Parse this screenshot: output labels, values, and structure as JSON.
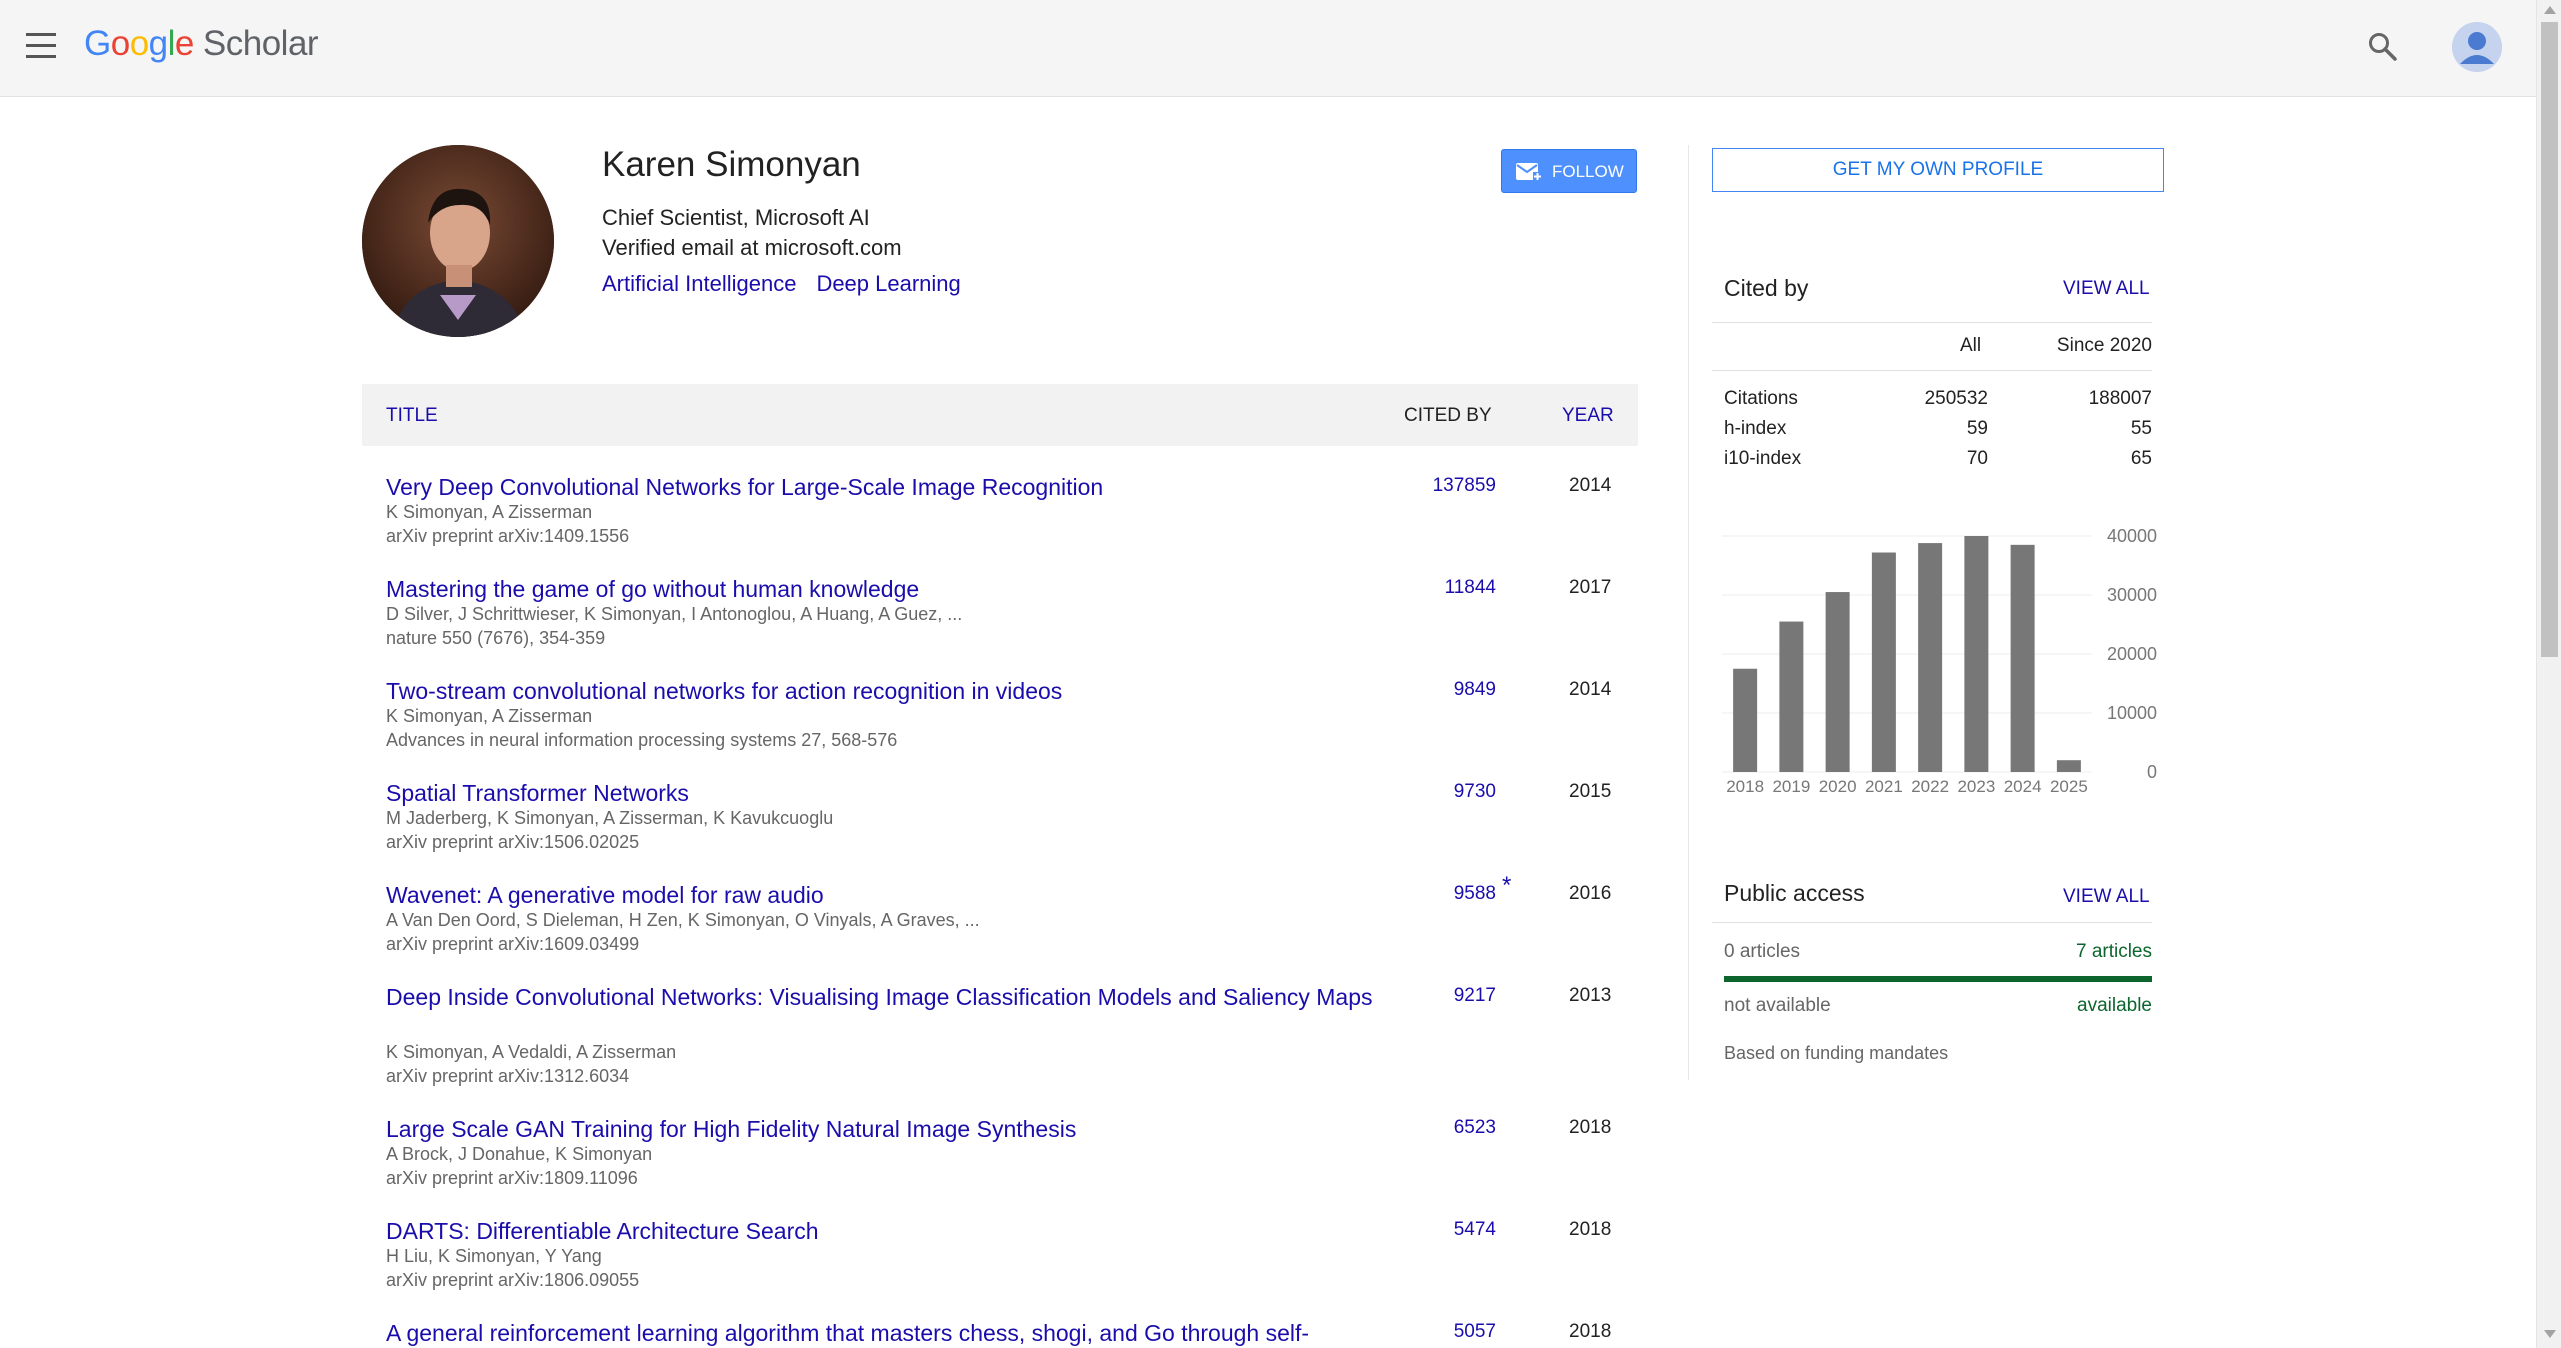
{
  "header": {
    "logo_letters": [
      "G",
      "o",
      "o",
      "g",
      "l",
      "e"
    ],
    "product": "Scholar"
  },
  "profile": {
    "name": "Karen Simonyan",
    "affiliation": "Chief Scientist, Microsoft AI",
    "email": "Verified email at microsoft.com",
    "interests": [
      "Artificial Intelligence",
      "Deep Learning"
    ],
    "follow_label": "FOLLOW"
  },
  "table": {
    "headers": {
      "title": "TITLE",
      "cited_by": "CITED BY",
      "year": "YEAR"
    },
    "rows": [
      {
        "title": "Very Deep Convolutional Networks for Large-Scale Image Recognition",
        "authors": "K Simonyan, A Zisserman",
        "venue": "arXiv preprint arXiv:1409.1556",
        "cited": "137859",
        "year": "2014",
        "star": ""
      },
      {
        "title": "Mastering the game of go without human knowledge",
        "authors": "D Silver, J Schrittwieser, K Simonyan, I Antonoglou, A Huang, A Guez, ...",
        "venue": "nature 550 (7676), 354-359",
        "cited": "11844",
        "year": "2017",
        "star": ""
      },
      {
        "title": "Two-stream convolutional networks for action recognition in videos",
        "authors": "K Simonyan, A Zisserman",
        "venue": "Advances in neural information processing systems 27, 568-576",
        "cited": "9849",
        "year": "2014",
        "star": ""
      },
      {
        "title": "Spatial Transformer Networks",
        "authors": "M Jaderberg, K Simonyan, A Zisserman, K Kavukcuoglu",
        "venue": "arXiv preprint arXiv:1506.02025",
        "cited": "9730",
        "year": "2015",
        "star": ""
      },
      {
        "title": "Wavenet: A generative model for raw audio",
        "authors": "A Van Den Oord, S Dieleman, H Zen, K Simonyan, O Vinyals, A Graves, ...",
        "venue": "arXiv preprint arXiv:1609.03499",
        "cited": "9588",
        "year": "2016",
        "star": "*"
      },
      {
        "title": "Deep Inside Convolutional Networks: Visualising Image Classification Models and Saliency Maps",
        "authors": "K Simonyan, A Vedaldi, A Zisserman",
        "venue": "arXiv preprint arXiv:1312.6034",
        "cited": "9217",
        "year": "2013",
        "star": ""
      },
      {
        "title": "Large Scale GAN Training for High Fidelity Natural Image Synthesis",
        "authors": "A Brock, J Donahue, K Simonyan",
        "venue": "arXiv preprint arXiv:1809.11096",
        "cited": "6523",
        "year": "2018",
        "star": ""
      },
      {
        "title": "DARTS: Differentiable Architecture Search",
        "authors": "H Liu, K Simonyan, Y Yang",
        "venue": "arXiv preprint arXiv:1806.09055",
        "cited": "5474",
        "year": "2018",
        "star": ""
      },
      {
        "title": "A general reinforcement learning algorithm that masters chess, shogi, and Go through self-",
        "authors": "",
        "venue": "",
        "cited": "5057",
        "year": "2018",
        "star": ""
      }
    ]
  },
  "sidebar": {
    "own_profile_label": "GET MY OWN PROFILE",
    "cited_by": {
      "title": "Cited by",
      "view_all": "VIEW ALL",
      "col_all": "All",
      "col_since": "Since 2020",
      "metrics": [
        {
          "label": "Citations",
          "all": "250532",
          "since": "188007"
        },
        {
          "label": "h-index",
          "all": "59",
          "since": "55"
        },
        {
          "label": "i10-index",
          "all": "70",
          "since": "65"
        }
      ]
    },
    "public_access": {
      "title": "Public access",
      "view_all": "VIEW ALL",
      "not_available_count": "0 articles",
      "available_count": "7 articles",
      "not_available_label": "not available",
      "available_label": "available",
      "available_fraction": 1.0,
      "note": "Based on funding mandates"
    }
  },
  "chart_data": {
    "type": "bar",
    "categories": [
      "2018",
      "2019",
      "2020",
      "2021",
      "2022",
      "2023",
      "2024",
      "2025"
    ],
    "values": [
      17500,
      25500,
      30500,
      37200,
      38800,
      40000,
      38500,
      2000
    ],
    "ylim": [
      0,
      40000
    ],
    "yticks": [
      "0",
      "10000",
      "20000",
      "30000",
      "40000"
    ],
    "grid": true,
    "color": "#777777"
  },
  "colors": {
    "link": "#1a0dab",
    "accent": "#4d90fe",
    "available": "#0d652d"
  }
}
